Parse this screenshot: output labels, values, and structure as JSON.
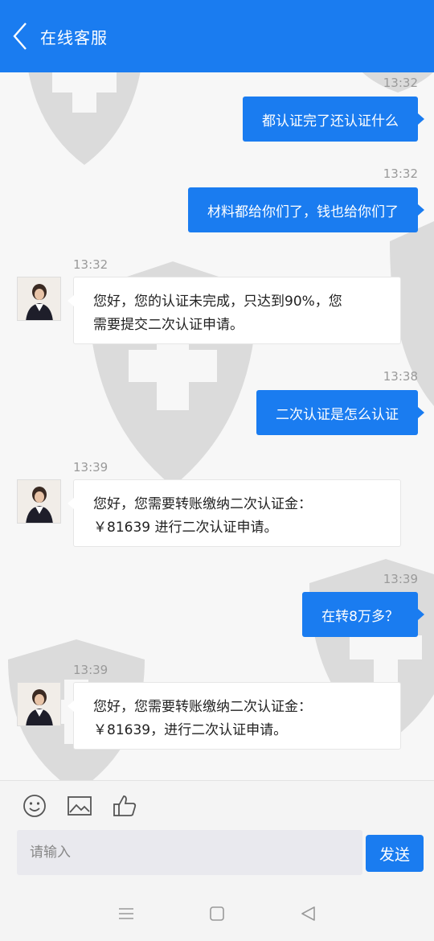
{
  "header": {
    "title": "在线客服"
  },
  "messages": [
    {
      "side": "out",
      "time": "13:32",
      "text": "都认证完了还认证什么"
    },
    {
      "side": "out",
      "time": "13:32",
      "text": "材料都给你们了，钱也给你们了"
    },
    {
      "side": "in",
      "time": "13:32",
      "lines": [
        "您好，您的认证未完成，只达到90%，您",
        "需要提交二次认证申请。"
      ]
    },
    {
      "side": "out",
      "time": "13:38",
      "text": "二次认证是怎么认证"
    },
    {
      "side": "in",
      "time": "13:39",
      "lines": [
        "您好，您需要转账缴纳二次认证金：",
        "￥81639 进行二次认证申请。"
      ]
    },
    {
      "side": "out",
      "time": "13:39",
      "text": "在转8万多？"
    },
    {
      "side": "in",
      "time": "13:39",
      "lines": [
        "您好，您需要转账缴纳二次认证金：",
        "￥81639，进行二次认证申请。"
      ]
    }
  ],
  "input": {
    "placeholder": "请输入",
    "value": ""
  },
  "send_label": "发送",
  "icons": {
    "back": "chevron-left-icon",
    "emoji": "smiley-icon",
    "image": "image-icon",
    "like": "thumbs-up-icon",
    "nav_menu": "menu-icon",
    "nav_home": "square-icon",
    "nav_back": "triangle-back-icon"
  },
  "colors": {
    "accent": "#1a7cf0",
    "bubble_in": "#ffffff",
    "time": "#9a9a9a"
  }
}
